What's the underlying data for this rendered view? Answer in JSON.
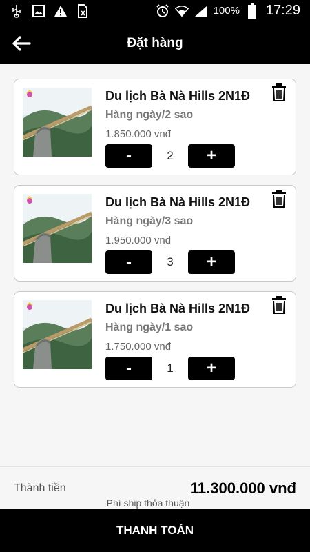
{
  "status_bar": {
    "battery_percent": "100%",
    "time": "17:29",
    "icons": [
      "usb-icon",
      "image-icon",
      "warning-icon",
      "sim-off-icon",
      "alarm-icon",
      "wifi-icon",
      "signal-icon",
      "battery-icon"
    ]
  },
  "app_bar": {
    "title": "Đặt hàng",
    "back_icon": "arrow-left-icon"
  },
  "cart": {
    "items": [
      {
        "title": "Du lịch Bà Nà Hills 2N1Đ",
        "variant": "Hàng ngày/2 sao",
        "price": "1.850.000 vnđ",
        "quantity": "2",
        "minus": "-",
        "plus": "+"
      },
      {
        "title": "Du lịch Bà Nà Hills 2N1Đ",
        "variant": "Hàng ngày/3 sao",
        "price": "1.950.000 vnđ",
        "quantity": "3",
        "minus": "-",
        "plus": "+"
      },
      {
        "title": "Du lịch Bà Nà Hills 2N1Đ",
        "variant": "Hàng ngày/1 sao",
        "price": "1.750.000 vnđ",
        "quantity": "1",
        "minus": "-",
        "plus": "+"
      }
    ]
  },
  "footer": {
    "total_label": "Thành tiền",
    "total_value": "11.300.000 vnđ",
    "ship_note": "Phí ship thỏa thuận",
    "pay_label": "THANH TOÁN"
  },
  "colors": {
    "bar_bg": "#000000",
    "page_bg": "#f6f6f6",
    "card_border": "#c9c9c9",
    "variant_text": "#777777"
  }
}
